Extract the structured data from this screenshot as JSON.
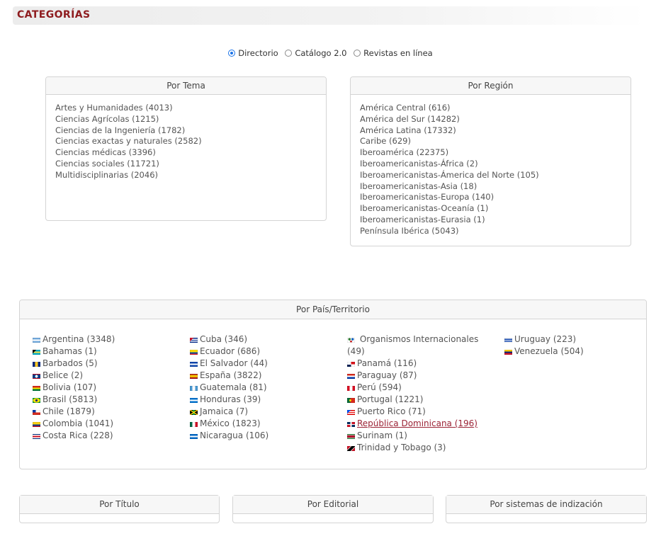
{
  "header": {
    "title": "CATEGORÍAS"
  },
  "view_options": [
    {
      "label": "Directorio",
      "checked": true
    },
    {
      "label": "Catálogo 2.0",
      "checked": false
    },
    {
      "label": "Revistas en línea",
      "checked": false
    }
  ],
  "por_tema": {
    "title": "Por Tema",
    "items": [
      "Artes y Humanidades (4013)",
      "Ciencias Agrícolas (1215)",
      "Ciencias de la Ingeniería (1782)",
      "Ciencias exactas y naturales (2582)",
      "Ciencias médicas (3396)",
      "Ciencias sociales (11721)",
      "Multidisciplinarias (2046)"
    ]
  },
  "por_region": {
    "title": "Por Región",
    "items": [
      "América Central (616)",
      "América del Sur (14282)",
      "América Latina (17332)",
      "Caribe (629)",
      "Iberoamérica (22375)",
      "Iberoamericanistas-África (2)",
      "Iberoamericanistas-Ámerica del Norte (105)",
      "Iberoamericanistas-Asia (18)",
      "Iberoamericanistas-Europa (140)",
      "Iberoamericanistas-Oceanía (1)",
      "Iberoamericanistas-Eurasia (1)",
      "Península Ibérica (5043)"
    ]
  },
  "por_pais": {
    "title": "Por País/Territorio",
    "columns": [
      [
        {
          "label": "Argentina (3348)",
          "flag": "argentina"
        },
        {
          "label": "Bahamas (1)",
          "flag": "bahamas"
        },
        {
          "label": "Barbados (5)",
          "flag": "barbados"
        },
        {
          "label": "Belice (2)",
          "flag": "belize"
        },
        {
          "label": "Bolivia (107)",
          "flag": "bolivia"
        },
        {
          "label": "Brasil (5813)",
          "flag": "brazil"
        },
        {
          "label": "Chile (1879)",
          "flag": "chile"
        },
        {
          "label": "Colombia (1041)",
          "flag": "colombia"
        },
        {
          "label": "Costa Rica (228)",
          "flag": "costa-rica"
        }
      ],
      [
        {
          "label": "Cuba (346)",
          "flag": "cuba"
        },
        {
          "label": "Ecuador (686)",
          "flag": "ecuador"
        },
        {
          "label": "El Salvador (44)",
          "flag": "el-salvador"
        },
        {
          "label": "España (3822)",
          "flag": "spain"
        },
        {
          "label": "Guatemala (81)",
          "flag": "guatemala"
        },
        {
          "label": "Honduras (39)",
          "flag": "honduras"
        },
        {
          "label": "Jamaica (7)",
          "flag": "jamaica"
        },
        {
          "label": "México (1823)",
          "flag": "mexico"
        },
        {
          "label": "Nicaragua (106)",
          "flag": "nicaragua"
        }
      ],
      [
        {
          "label": "Organismos Internacionales (49)",
          "flag": "international"
        },
        {
          "label": "Panamá (116)",
          "flag": "panama"
        },
        {
          "label": "Paraguay (87)",
          "flag": "paraguay"
        },
        {
          "label": "Perú (594)",
          "flag": "peru"
        },
        {
          "label": "Portugal (1221)",
          "flag": "portugal"
        },
        {
          "label": "Puerto Rico (71)",
          "flag": "puerto-rico"
        },
        {
          "label": "República Dominicana (196)",
          "flag": "dominican-republic",
          "active": true
        },
        {
          "label": "Surinam (1)",
          "flag": "suriname"
        },
        {
          "label": "Trinidad y Tobago (3)",
          "flag": "trinidad-tobago"
        }
      ],
      [
        {
          "label": "Uruguay (223)",
          "flag": "uruguay"
        },
        {
          "label": "Venezuela (504)",
          "flag": "venezuela"
        }
      ]
    ]
  },
  "bottom_panels": [
    {
      "title": "Por Título"
    },
    {
      "title": "Por Editorial"
    },
    {
      "title": "Por sistemas de indización"
    }
  ],
  "colors": {
    "accent": "#8e1c1f",
    "link_active": "#9b2335",
    "radio_checked": "#1a73e8",
    "panel_border": "#d4d4d4"
  }
}
